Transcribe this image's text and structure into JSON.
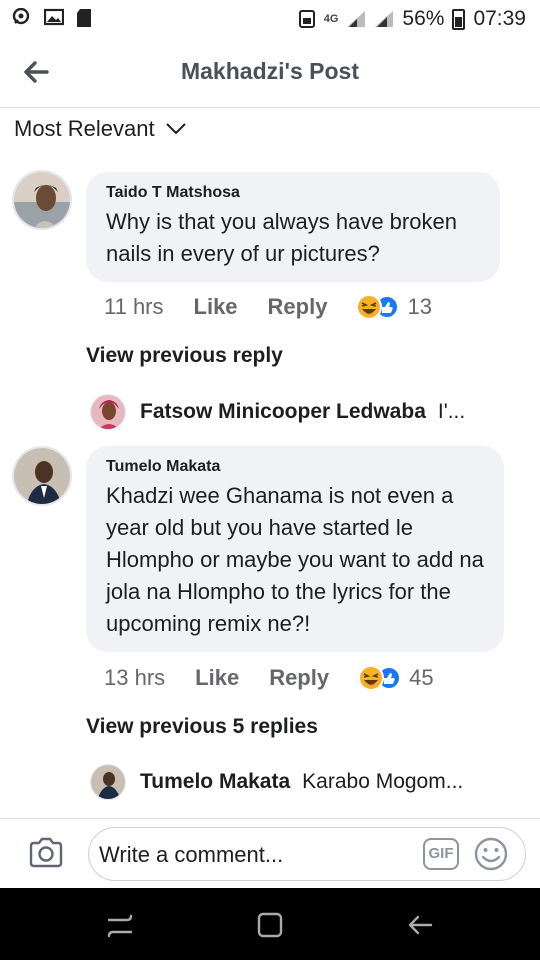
{
  "status_bar": {
    "network": "4G",
    "battery": "56%",
    "time": "07:39"
  },
  "header": {
    "title": "Makhadzi's Post",
    "back_icon": "arrow-left-icon"
  },
  "sort": {
    "label": "Most Relevant",
    "icon": "chevron-down-icon"
  },
  "comments": [
    {
      "name": "Taido T Matshosa",
      "text": "Why is that you always have broken nails in every of ur pictures?",
      "time": "11 hrs",
      "like": "Like",
      "reply": "Reply",
      "reaction_count": "13",
      "view_previous": "View previous reply",
      "reply_preview": {
        "name": "Fatsow Minicooper Ledwaba",
        "text": "I'..."
      }
    },
    {
      "name": "Tumelo Makata",
      "text": "Khadzi wee Ghanama is not even a year old but you have started le Hlompho or maybe you want to add na jola na Hlompho to the lyrics for the upcoming remix ne?!",
      "time": "13 hrs",
      "like": "Like",
      "reply": "Reply",
      "reaction_count": "45",
      "view_previous": "View previous 5 replies",
      "reply_preview": {
        "name": "Tumelo Makata",
        "text": "Karabo Mogom..."
      }
    }
  ],
  "composer": {
    "placeholder": "Write a comment...",
    "gif_label": "GIF"
  },
  "colors": {
    "bubble": "#f0f2f5",
    "secondary_text": "#65676b",
    "haha": "#f7b125",
    "like_blue": "#1877f2"
  }
}
